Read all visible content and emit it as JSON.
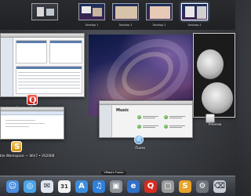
{
  "spaces": [
    {
      "label": "",
      "kind": "dashboard"
    },
    {
      "label": "Desktop 1",
      "kind": "desktop"
    },
    {
      "label": "Desktop 3",
      "kind": "desktop"
    },
    {
      "label": "Desktop 2",
      "kind": "desktop"
    },
    {
      "label": "Desktop 4",
      "kind": "desktop"
    }
  ],
  "windows": {
    "quicken": {
      "caption": "Quicken Essentials"
    },
    "photo": {
      "caption": "Preview"
    },
    "music": {
      "title": "Music",
      "caption": "iTunes"
    },
    "vm": {
      "caption": "ble Workspace — Win7 • VS2008"
    }
  },
  "dock": {
    "tooltip": "VMware Fusion",
    "items": [
      {
        "name": "finder",
        "icon": "finder-icon",
        "color": "#4c8fe0"
      },
      {
        "name": "safari",
        "icon": "safari-icon",
        "color": "#4aa3e8"
      },
      {
        "name": "mail",
        "icon": "mail-icon",
        "color": "#dfe6ef"
      },
      {
        "name": "ical",
        "icon": "calendar-icon",
        "color": "#f1f1f1"
      },
      {
        "name": "app-store",
        "icon": "app-store-icon",
        "color": "#3e8ede"
      },
      {
        "name": "itunes",
        "icon": "itunes-icon",
        "color": "#2f82da"
      },
      {
        "name": "vmware",
        "icon": "vmware-icon",
        "color": "#8e9399"
      },
      {
        "name": "ie",
        "icon": "internet-explorer-icon",
        "color": "#2f70c9"
      },
      {
        "name": "quicken",
        "icon": "quicken-icon",
        "color": "#d92a20"
      },
      {
        "name": "photo",
        "icon": "photo-icon",
        "color": "#9a9a9a"
      },
      {
        "name": "workspace",
        "icon": "workspace-icon",
        "color": "#e8a32a"
      },
      {
        "name": "utility",
        "icon": "utility-icon",
        "color": "#6f747b"
      },
      {
        "name": "trash",
        "icon": "trash-icon",
        "color": "#c7cdd4"
      }
    ]
  },
  "colors": {
    "quicken_red": "#d92a20",
    "vm_orange": "#e8a32a",
    "itunes_blue": "#2f82da",
    "background": "#3a3d42"
  }
}
